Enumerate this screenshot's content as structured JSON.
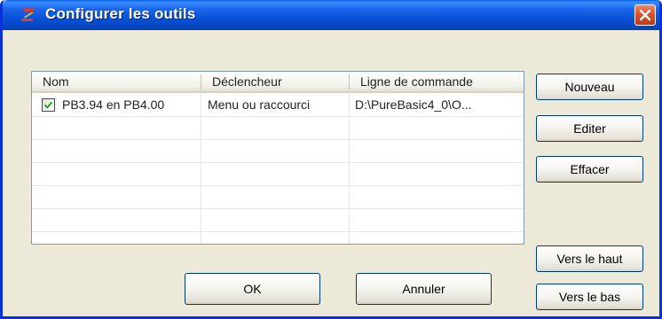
{
  "window": {
    "title": "Configurer les outils",
    "app_icon": "purebasic-icon",
    "close_icon": "close-icon"
  },
  "listview": {
    "columns": [
      "Nom",
      "Déclencheur",
      "Ligne de commande"
    ],
    "rows": [
      {
        "checked": true,
        "name": "PB3.94 en PB4.00",
        "trigger": "Menu ou raccourci",
        "command": "D:\\PureBasic4_0\\O..."
      }
    ]
  },
  "side_buttons": {
    "new": "Nouveau",
    "edit": "Editer",
    "delete": "Effacer",
    "move_up": "Vers le haut",
    "move_down": "Vers le bas"
  },
  "dialog_buttons": {
    "ok": "OK",
    "cancel": "Annuler"
  },
  "colors": {
    "titlebar": "#0852d6",
    "dialog_bg": "#ece9d8",
    "close_button": "#d6552f",
    "button_border": "#003c74",
    "checkmark": "#21a121"
  }
}
